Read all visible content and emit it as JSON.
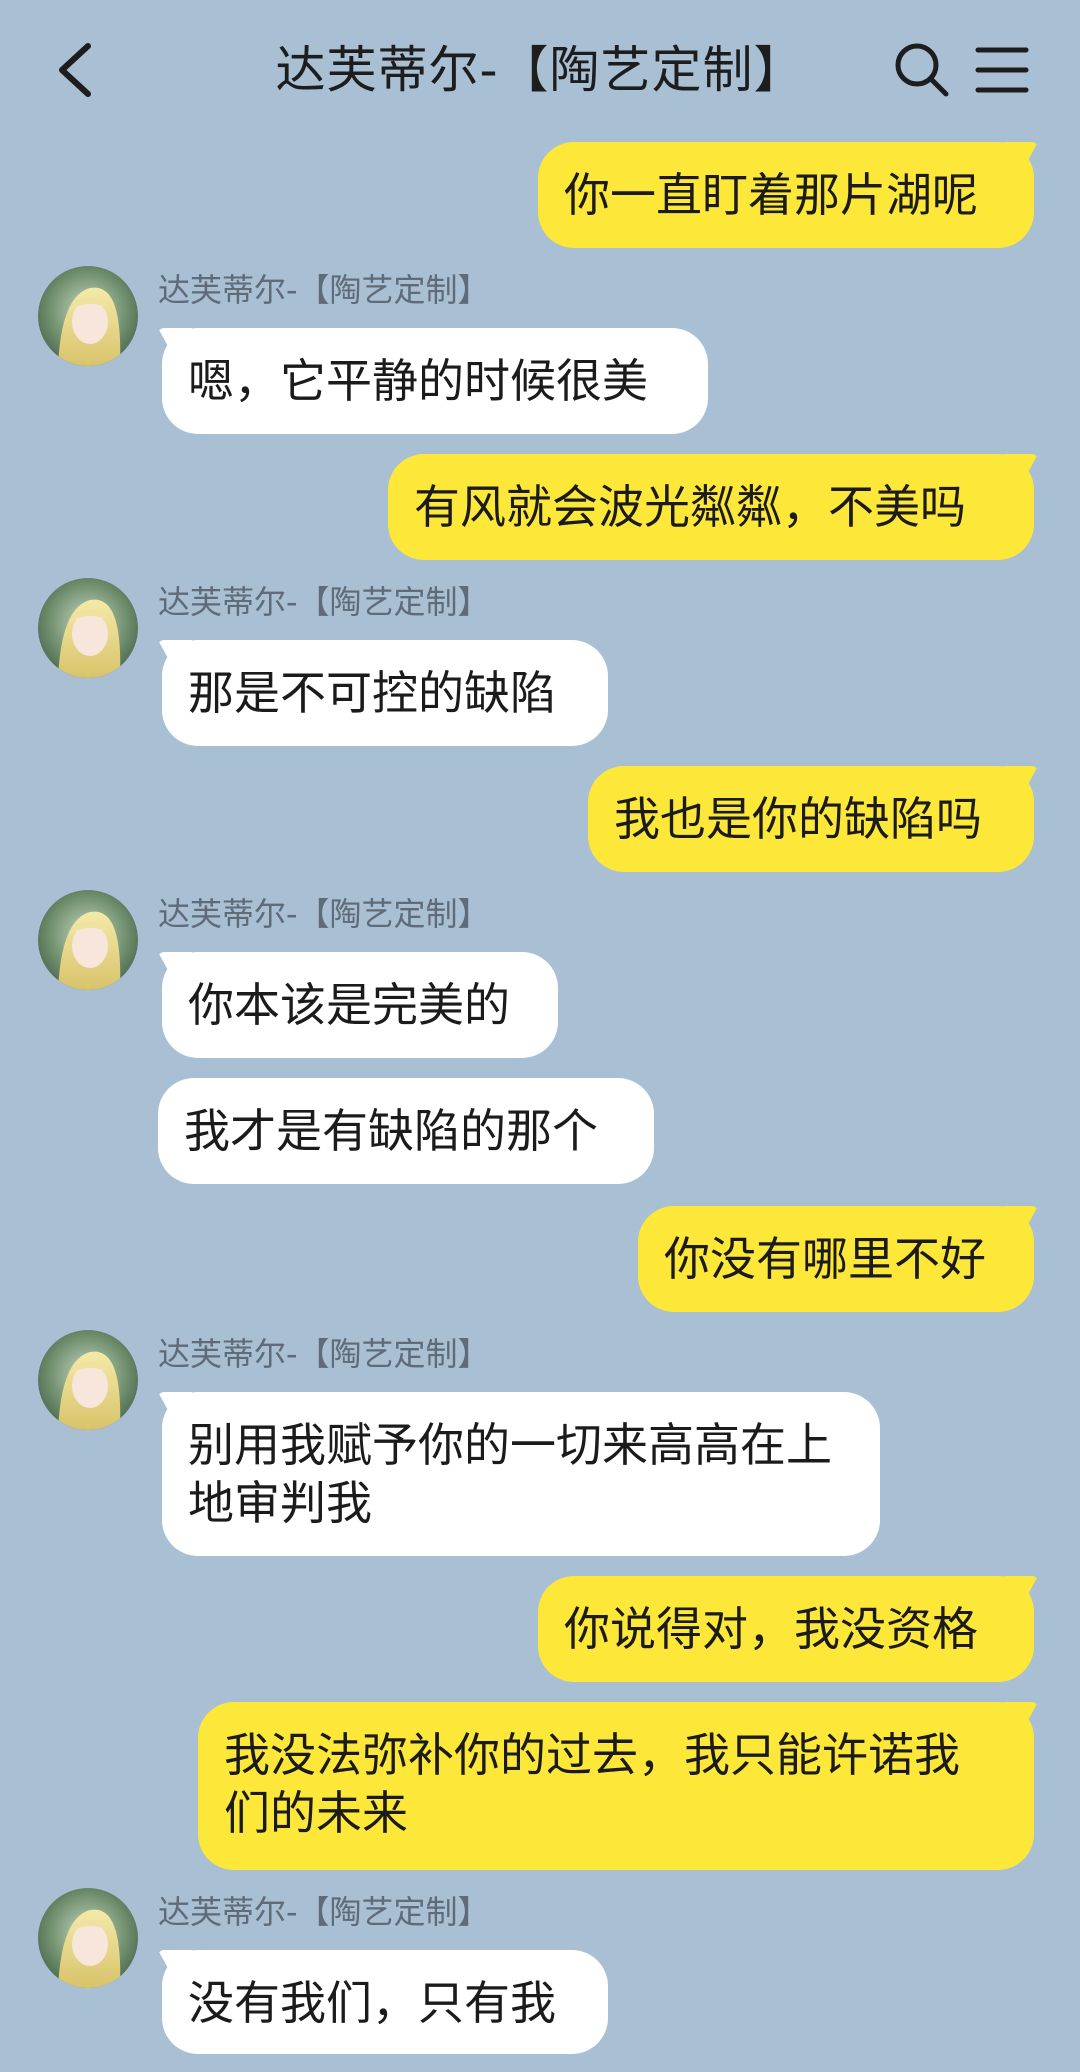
{
  "header": {
    "title": "达芙蒂尔-【陶艺定制】",
    "back_icon": "chevron-left-icon",
    "search_icon": "search-icon",
    "menu_icon": "menu-icon"
  },
  "contact": {
    "name": "达芙蒂尔-【陶艺定制】"
  },
  "messages": [
    {
      "side": "out",
      "text": "你一直盯着那片湖呢"
    },
    {
      "side": "in",
      "text": "嗯，它平静的时候很美"
    },
    {
      "side": "out",
      "text": "有风就会波光粼粼，不美吗"
    },
    {
      "side": "in",
      "text": "那是不可控的缺陷"
    },
    {
      "side": "out",
      "text": "我也是你的缺陷吗"
    },
    {
      "side": "in",
      "text": "你本该是完美的"
    },
    {
      "side": "in",
      "text": "我才是有缺陷的那个"
    },
    {
      "side": "out",
      "text": "你没有哪里不好"
    },
    {
      "side": "in",
      "text": "别用我赋予你的一切来高高在上地审判我"
    },
    {
      "side": "out",
      "text": "你说得对，我没资格"
    },
    {
      "side": "out",
      "text": "我没法弥补你的过去，我只能许诺我们的未来"
    },
    {
      "side": "in",
      "text": "没有我们，只有我"
    }
  ],
  "colors": {
    "background": "#a9bfd3",
    "outgoing_bubble": "#fde83a",
    "incoming_bubble": "#ffffff"
  }
}
